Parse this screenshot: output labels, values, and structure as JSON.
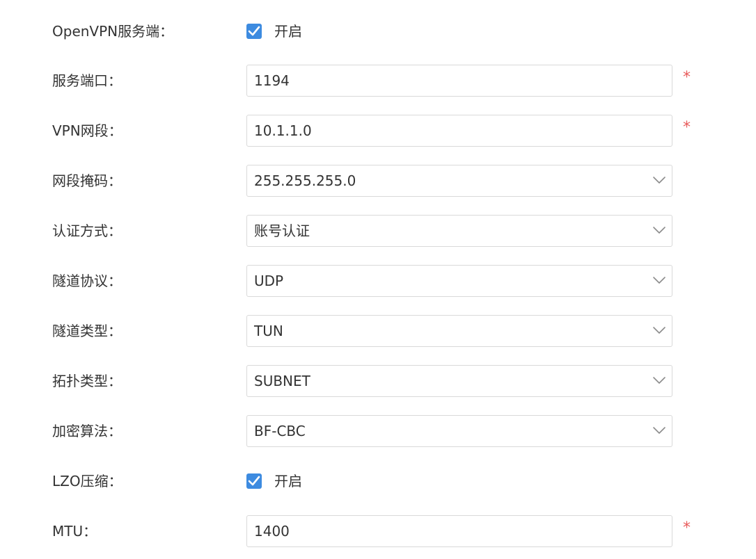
{
  "colors": {
    "accent": "#3d8be0",
    "required": "#e85a5a",
    "border": "#d9d9d9",
    "text": "#333333",
    "chevron": "#8c8c8c"
  },
  "icons": {
    "checkbox_checked": "checkbox-checked-icon",
    "dropdown": "chevron-down-icon",
    "required": "asterisk"
  },
  "required_mark": "*",
  "form": {
    "openvpn_server": {
      "label": "OpenVPN服务端：",
      "checked": true,
      "text": "开启"
    },
    "service_port": {
      "label": "服务端口：",
      "value": "1194",
      "required": true
    },
    "vpn_subnet": {
      "label": "VPN网段：",
      "value": "10.1.1.0",
      "required": true
    },
    "subnet_mask": {
      "label": "网段掩码：",
      "value": "255.255.255.0"
    },
    "auth_method": {
      "label": "认证方式：",
      "value": "账号认证"
    },
    "tunnel_protocol": {
      "label": "隧道协议：",
      "value": "UDP"
    },
    "tunnel_type": {
      "label": "隧道类型：",
      "value": "TUN"
    },
    "topology_type": {
      "label": "拓扑类型：",
      "value": "SUBNET"
    },
    "encryption": {
      "label": "加密算法：",
      "value": "BF-CBC"
    },
    "lzo": {
      "label": "LZO压缩：",
      "checked": true,
      "text": "开启"
    },
    "mtu": {
      "label": "MTU：",
      "value": "1400",
      "required": true
    }
  }
}
